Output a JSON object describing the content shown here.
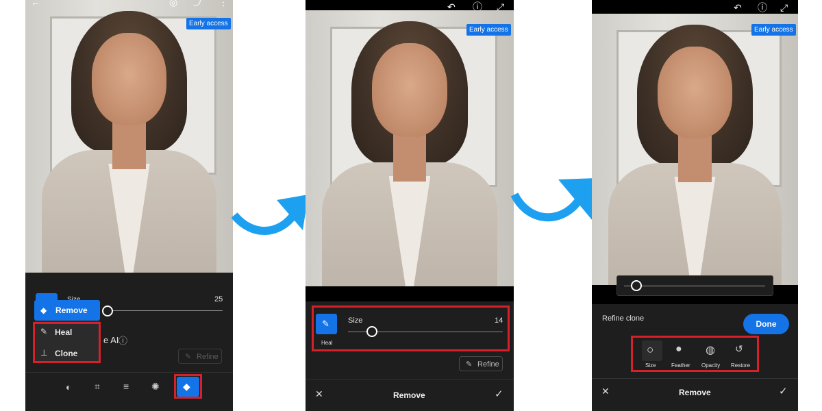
{
  "colors": {
    "accent": "#1473e6",
    "highlight": "#d6212a",
    "panel": "#1e1e1e"
  },
  "panel1": {
    "badge": "Early access",
    "size_label": "Size",
    "size_value": "25",
    "menu": {
      "remove": "Remove",
      "heal": "Heal",
      "clone": "Clone"
    },
    "partial_text": "e AI",
    "refine_label": "Refine",
    "toolbar_icons": [
      "blend-icon",
      "crop-icon",
      "adjust-icon",
      "effects-icon",
      "eraser-icon"
    ]
  },
  "panel2": {
    "badge": "Early access",
    "tool_label": "Heal",
    "size_label": "Size",
    "size_value": "14",
    "refine_label": "Refine",
    "footer_title": "Remove"
  },
  "panel3": {
    "badge": "Early access",
    "refine_title": "Refine clone",
    "done_label": "Done",
    "options": [
      "Size",
      "Feather",
      "Opacity",
      "Restore"
    ],
    "footer_title": "Remove"
  }
}
